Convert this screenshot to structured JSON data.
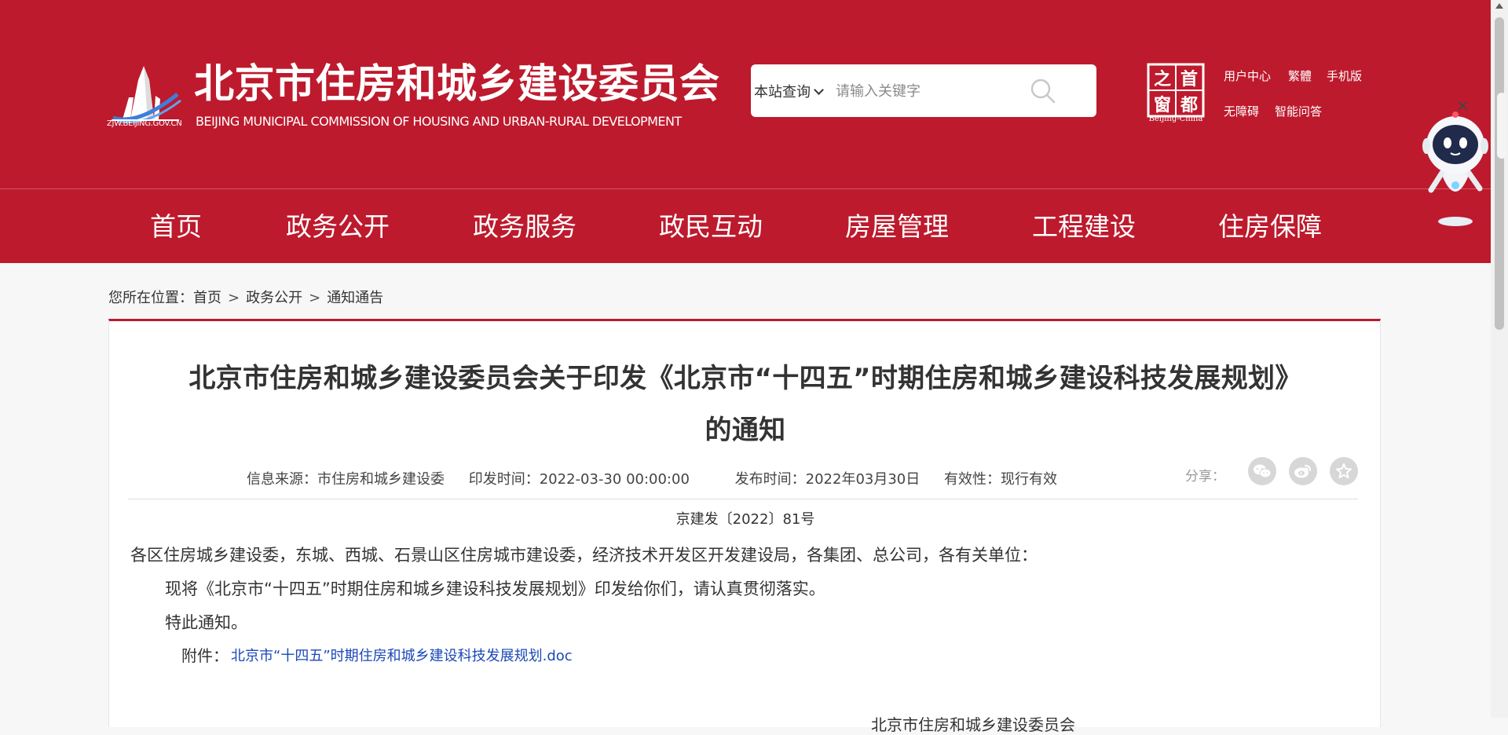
{
  "header": {
    "logo_caption": "ZJW.BEIJING.GOV.CN",
    "site_title": "北京市住房和城乡建设委员会",
    "site_subtitle": "BEIJING MUNICIPAL COMMISSION OF HOUSING AND URBAN-RURAL DEVELOPMENT",
    "search": {
      "scope_label": "本站查询",
      "placeholder": "请输入关键字",
      "value": ""
    },
    "capital_badge": {
      "chars": [
        "首",
        "都",
        "之",
        "窗"
      ],
      "caption": "Beijing-China"
    },
    "top_links": {
      "user_center": "用户中心",
      "traditional": "繁體",
      "mobile": "手机版",
      "accessibility": "无障碍",
      "smart_qa": "智能问答"
    },
    "brand_color": "#bd1a2d"
  },
  "nav": {
    "items": [
      "首页",
      "政务公开",
      "政务服务",
      "政民互动",
      "房屋管理",
      "工程建设",
      "住房保障"
    ]
  },
  "assistant": {
    "close_glyph": "×"
  },
  "breadcrumb": {
    "prefix": "您所在位置：",
    "items": [
      "首页",
      "政务公开",
      "通知通告"
    ],
    "separator": ">"
  },
  "article": {
    "title_line1": "北京市住房和城乡建设委员会关于印发《北京市“十四五”时期住房和城乡建设科技发展规划》",
    "title_line2": "的通知",
    "meta": {
      "source": "信息来源：市住房和城乡建设委",
      "issued": "印发时间：2022-03-30 00:00:00",
      "published": "发布时间：2022年03月30日",
      "validity": "有效性：现行有效"
    },
    "share_label": "分享：",
    "doc_number": "京建发〔2022〕81号",
    "recipients": "各区住房城乡建设委，东城、西城、石景山区住房城市建设委，经济技术开发区开发建设局，各集团、总公司，各有关单位：",
    "paragraph1": "现将《北京市“十四五”时期住房和城乡建设科技发展规划》印发给你们，请认真贯彻落实。",
    "paragraph2": "特此通知。",
    "attachment_label": "附件：",
    "attachment_link": "北京市“十四五”时期住房和城乡建设科技发展规划.doc",
    "signature": "北京市住房和城乡建设委员会",
    "link_color": "#1a48b8"
  }
}
